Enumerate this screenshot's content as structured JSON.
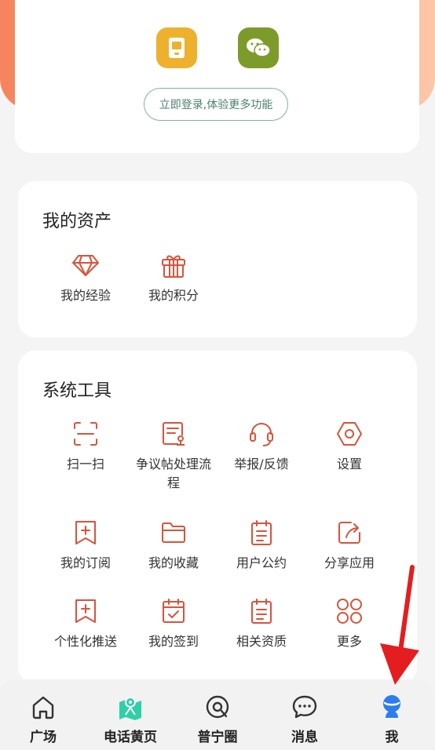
{
  "login": {
    "app_icons": [
      {
        "name": "phone-app-icon",
        "color": "#edb12d"
      },
      {
        "name": "wechat-icon",
        "color": "#7d9b2a"
      }
    ],
    "login_button": "立即登录,体验更多功能"
  },
  "assets": {
    "title": "我的资产",
    "items": [
      {
        "icon": "diamond-icon",
        "label": "我的经验"
      },
      {
        "icon": "gift-icon",
        "label": "我的积分"
      }
    ]
  },
  "tools": {
    "title": "系统工具",
    "items": [
      {
        "icon": "scan-icon",
        "label": "扫一扫"
      },
      {
        "icon": "dispute-post-icon",
        "label": "争议帖处理流程"
      },
      {
        "icon": "headset-icon",
        "label": "举报/反馈"
      },
      {
        "icon": "settings-icon",
        "label": "设置"
      },
      {
        "icon": "bookmark-plus-icon",
        "label": "我的订阅"
      },
      {
        "icon": "folder-icon",
        "label": "我的收藏"
      },
      {
        "icon": "clipboard-icon",
        "label": "用户公约"
      },
      {
        "icon": "share-icon",
        "label": "分享应用"
      },
      {
        "icon": "bookmark-plus-icon",
        "label": "个性化推送"
      },
      {
        "icon": "calendar-check-icon",
        "label": "我的签到"
      },
      {
        "icon": "clipboard-icon",
        "label": "相关资质"
      },
      {
        "icon": "clover-icon",
        "label": "更多"
      }
    ]
  },
  "tabbar": {
    "items": [
      {
        "icon": "home-icon",
        "label": "广场"
      },
      {
        "icon": "map-icon",
        "label": "电话黄页"
      },
      {
        "icon": "circle-icon",
        "label": "普宁圈"
      },
      {
        "icon": "chat-icon",
        "label": "消息"
      },
      {
        "icon": "user-icon",
        "label": "我",
        "active": true
      }
    ]
  },
  "colors": {
    "accent": "#d9533b",
    "header_gradient_start": "#f6845e",
    "active_tab": "#2d7cf0",
    "map_tab": "#2fcfa8"
  }
}
